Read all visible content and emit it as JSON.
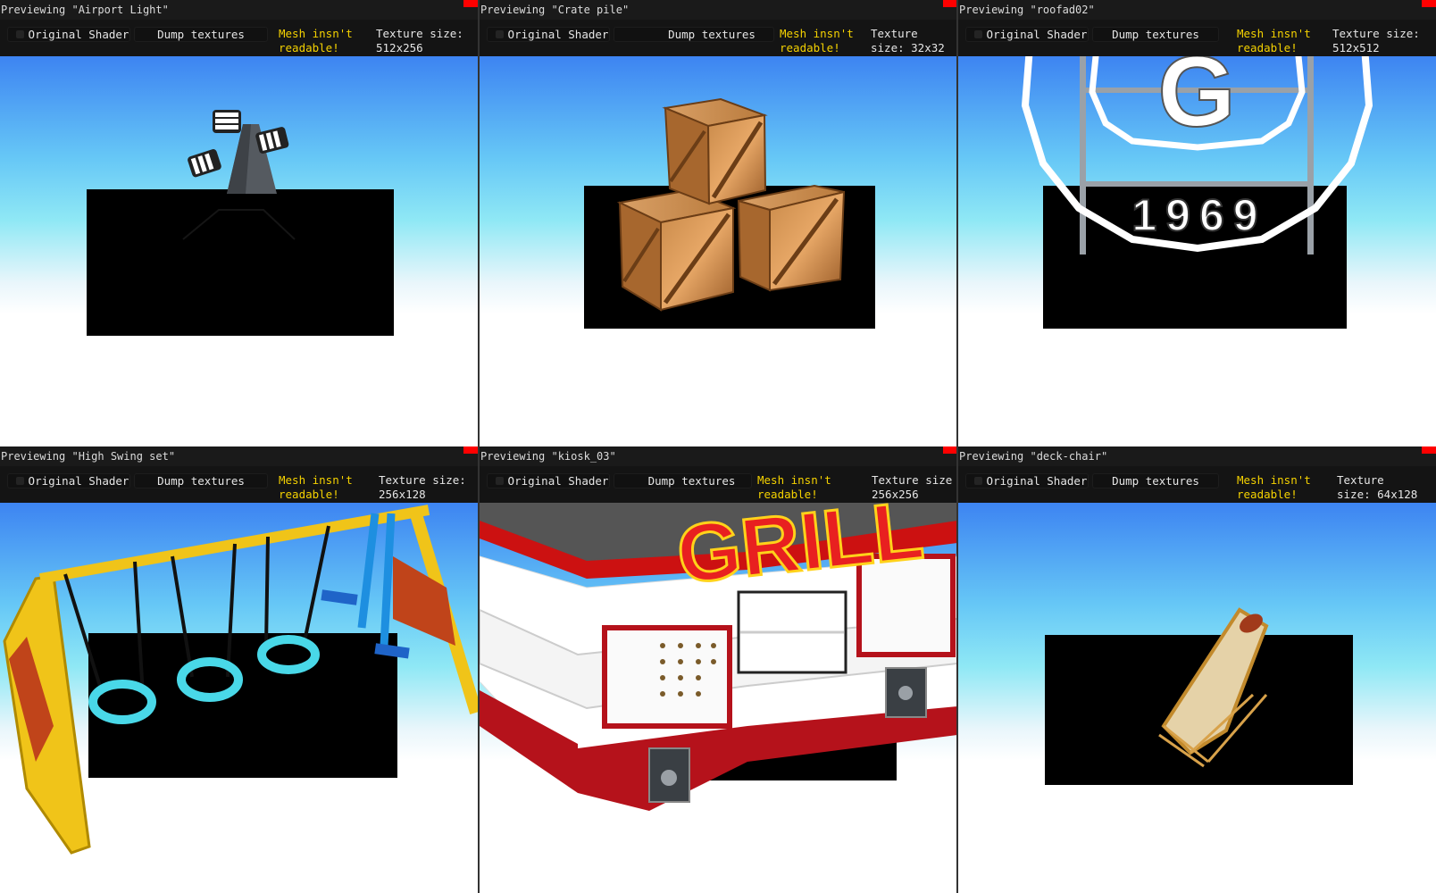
{
  "panels": [
    {
      "title": "Previewing \"Airport Light\"",
      "original_shader": "Original Shader",
      "dump_textures": "Dump textures",
      "warning": "Mesh insn't\nreadable!",
      "texture": "Texture size:\n512x256"
    },
    {
      "title": "Previewing \"Crate pile\"",
      "original_shader": "Original Shader",
      "dump_textures": "Dump textures",
      "warning": "Mesh insn't\nreadable!",
      "texture": "Texture\nsize: 32x32"
    },
    {
      "title": "Previewing \"roofad02\"",
      "original_shader": "Original Shader",
      "dump_textures": "Dump textures",
      "warning": "Mesh insn't\nreadable!",
      "texture": "Texture size:\n512x512",
      "sign_letter": "G",
      "sign_year": "1969"
    },
    {
      "title": "Previewing \"High Swing set\"",
      "original_shader": "Original Shader",
      "dump_textures": "Dump textures",
      "warning": "Mesh insn't\nreadable!",
      "texture": "Texture size:\n256x128"
    },
    {
      "title": "Previewing \"kiosk_03\"",
      "original_shader": "Original Shader",
      "dump_textures": "Dump textures",
      "warning": "Mesh insn't\nreadable!",
      "texture": "Texture size\n256x256",
      "sign_text": "GRILL"
    },
    {
      "title": "Previewing \"deck-chair\"",
      "original_shader": "Original Shader",
      "dump_textures": "Dump textures",
      "warning": "Mesh insn't\nreadable!",
      "texture": "Texture\nsize: 64x128"
    }
  ],
  "colors": {
    "warning": "#f5d200",
    "close": "#ff0000",
    "toolbar": "#141414"
  }
}
